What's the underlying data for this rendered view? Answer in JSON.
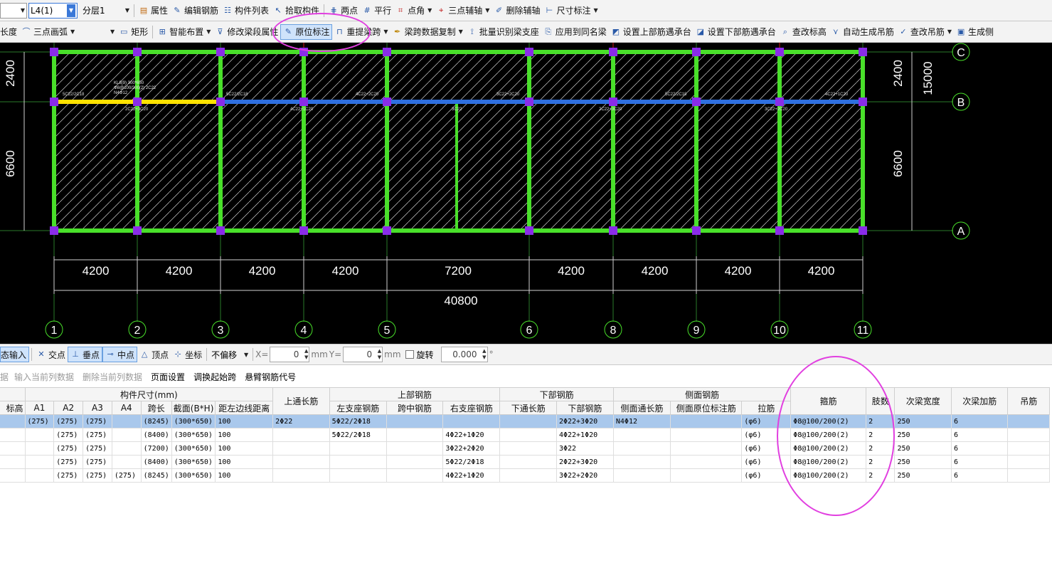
{
  "toolbar1": {
    "floor_select": "",
    "component_select": "L4(1)",
    "layer_select": "分层1",
    "properties": "属性",
    "edit_rebar": "编辑钢筋",
    "component_list": "构件列表",
    "pick_component": "拾取构件",
    "two_points": "两点",
    "parallel": "平行",
    "point_angle": "点角",
    "three_point_aux": "三点辅轴",
    "delete_aux": "删除辅轴",
    "dimension": "尺寸标注"
  },
  "toolbar2": {
    "length_label": "长度",
    "arc_tool": "三点画弧",
    "arc_combo": "",
    "rectangle": "矩形",
    "smart_layout": "智能布置",
    "modify_beam_section": "修改梁段属性",
    "original_annotation": "原位标注",
    "re_extract_span": "重提梁跨",
    "copy_span_data": "梁跨数据复制",
    "batch_identify_support": "批量识别梁支座",
    "apply_same_beam": "应用到同名梁",
    "set_top_rebar_cap": "设置上部筋遇承台",
    "set_bottom_rebar_cap": "设置下部筋遇承台",
    "check_elevation": "查改标高",
    "auto_hanger": "自动生成吊筋",
    "check_hanger": "查改吊筋",
    "generate_side": "生成侧"
  },
  "drawing": {
    "axes_x": [
      "1",
      "2",
      "3",
      "4",
      "5",
      "6",
      "8",
      "9",
      "10",
      "11"
    ],
    "axes_y": [
      "C",
      "B",
      "A"
    ],
    "spans_x": [
      "4200",
      "4200",
      "4200",
      "4200",
      "7200",
      "4200",
      "4200",
      "4200",
      "4200"
    ],
    "total_x": "40800",
    "spans_y": [
      "2400",
      "6600"
    ],
    "total_y": "15000",
    "beam_label_lines": [
      "KL8(9) 300*650",
      "Φ8@100/200(2) 2C22",
      "N4Φ12"
    ],
    "top_rebar_labels": [
      "5C22/2C18",
      "5C22/2C18",
      "4C22+2C20",
      "3C22+2C20",
      "5C22/2C18",
      "4C22+1C20"
    ],
    "bottom_rebar_labels": [
      "2C22+3C20",
      "4C22+1C20",
      "3C22",
      "2C22+3C20",
      "3C22+2C20"
    ]
  },
  "snapbar": {
    "dynamic_input": "态输入",
    "intersection": "交点",
    "perpendicular": "垂点",
    "midpoint": "中点",
    "vertex": "顶点",
    "coordinate": "坐标",
    "offset_select": "不偏移",
    "x_label": "X=",
    "x_value": "0",
    "mm1": "mm",
    "y_label": "Y=",
    "y_value": "0",
    "mm2": "mm",
    "rotate_label": "旋转",
    "rotate_value": "0.000",
    "degree": "°"
  },
  "tablemenu": {
    "item0": "据",
    "item1": "输入当前列数据",
    "item2": "删除当前列数据",
    "item3": "页面设置",
    "item4": "调换起始跨",
    "item5": "悬臂钢筋代号"
  },
  "table": {
    "group_headers": {
      "size": "构件尺寸(mm)",
      "top_long": "上通长筋",
      "top_rebar": "上部钢筋",
      "bottom_rebar": "下部钢筋",
      "side_rebar": "侧面钢筋",
      "stirrup": "箍筋",
      "legs": "肢数",
      "sec_beam_width": "次梁宽度",
      "sec_beam_add": "次梁加筋",
      "hanger": "吊筋"
    },
    "sub_headers": {
      "elev": "标高",
      "a1": "A1",
      "a2": "A2",
      "a3": "A3",
      "a4": "A4",
      "span_len": "跨长",
      "section": "截面(B*H)",
      "edge_dist": "距左边线距离",
      "left_support": "左支座钢筋",
      "mid_span": "跨中钢筋",
      "right_support": "右支座钢筋",
      "bottom_long": "下通长筋",
      "bottom_rebar": "下部钢筋",
      "side_long": "侧面通长筋",
      "side_orig": "侧面原位标注筋",
      "tie": "拉筋"
    },
    "rows": [
      {
        "elev": "",
        "a1": "(275)",
        "a2": "(275)",
        "a3": "(275)",
        "a4": "",
        "span_len": "(8245)",
        "section": "(300*650)",
        "edge_dist": "100",
        "top_long": "2Φ22",
        "left_support": "5Φ22/2Φ18",
        "mid_span": "",
        "right_support": "",
        "bottom_long": "",
        "bottom_rebar": "2Φ22+3Φ20",
        "side_long": "N4Φ12",
        "side_orig": "",
        "tie": "(φ6)",
        "stirrup": "Φ8@100/200(2)",
        "legs": "2",
        "sec_beam_width": "250",
        "sec_beam_add": "6",
        "hanger": ""
      },
      {
        "elev": "",
        "a1": "",
        "a2": "(275)",
        "a3": "(275)",
        "a4": "",
        "span_len": "(8400)",
        "section": "(300*650)",
        "edge_dist": "100",
        "top_long": "",
        "left_support": "5Φ22/2Φ18",
        "mid_span": "",
        "right_support": "4Φ22+1Φ20",
        "bottom_long": "",
        "bottom_rebar": "4Φ22+1Φ20",
        "side_long": "",
        "side_orig": "",
        "tie": "(φ6)",
        "stirrup": "Φ8@100/200(2)",
        "legs": "2",
        "sec_beam_width": "250",
        "sec_beam_add": "6",
        "hanger": ""
      },
      {
        "elev": "",
        "a1": "",
        "a2": "(275)",
        "a3": "(275)",
        "a4": "",
        "span_len": "(7200)",
        "section": "(300*650)",
        "edge_dist": "100",
        "top_long": "",
        "left_support": "",
        "mid_span": "",
        "right_support": "3Φ22+2Φ20",
        "bottom_long": "",
        "bottom_rebar": "3Φ22",
        "side_long": "",
        "side_orig": "",
        "tie": "(φ6)",
        "stirrup": "Φ8@100/200(2)",
        "legs": "2",
        "sec_beam_width": "250",
        "sec_beam_add": "6",
        "hanger": ""
      },
      {
        "elev": "",
        "a1": "",
        "a2": "(275)",
        "a3": "(275)",
        "a4": "",
        "span_len": "(8400)",
        "section": "(300*650)",
        "edge_dist": "100",
        "top_long": "",
        "left_support": "",
        "mid_span": "",
        "right_support": "5Φ22/2Φ18",
        "bottom_long": "",
        "bottom_rebar": "2Φ22+3Φ20",
        "side_long": "",
        "side_orig": "",
        "tie": "(φ6)",
        "stirrup": "Φ8@100/200(2)",
        "legs": "2",
        "sec_beam_width": "250",
        "sec_beam_add": "6",
        "hanger": ""
      },
      {
        "elev": "",
        "a1": "",
        "a2": "(275)",
        "a3": "(275)",
        "a4": "(275)",
        "span_len": "(8245)",
        "section": "(300*650)",
        "edge_dist": "100",
        "top_long": "",
        "left_support": "",
        "mid_span": "",
        "right_support": "4Φ22+1Φ20",
        "bottom_long": "",
        "bottom_rebar": "3Φ22+2Φ20",
        "side_long": "",
        "side_orig": "",
        "tie": "(φ6)",
        "stirrup": "Φ8@100/200(2)",
        "legs": "2",
        "sec_beam_width": "250",
        "sec_beam_add": "6",
        "hanger": ""
      }
    ]
  },
  "colors": {
    "canvas_bg": "#000000",
    "beam_green": "#49e02a",
    "beam_selected": "#ffe200",
    "beam_blue": "#2e6fe0",
    "axis_line": "#2a7a2a",
    "column_purple": "#8a2ce8",
    "axis_red": "#d01818",
    "annotation_circle": "#e13fe0",
    "row_selected": "#a9c8ec"
  }
}
